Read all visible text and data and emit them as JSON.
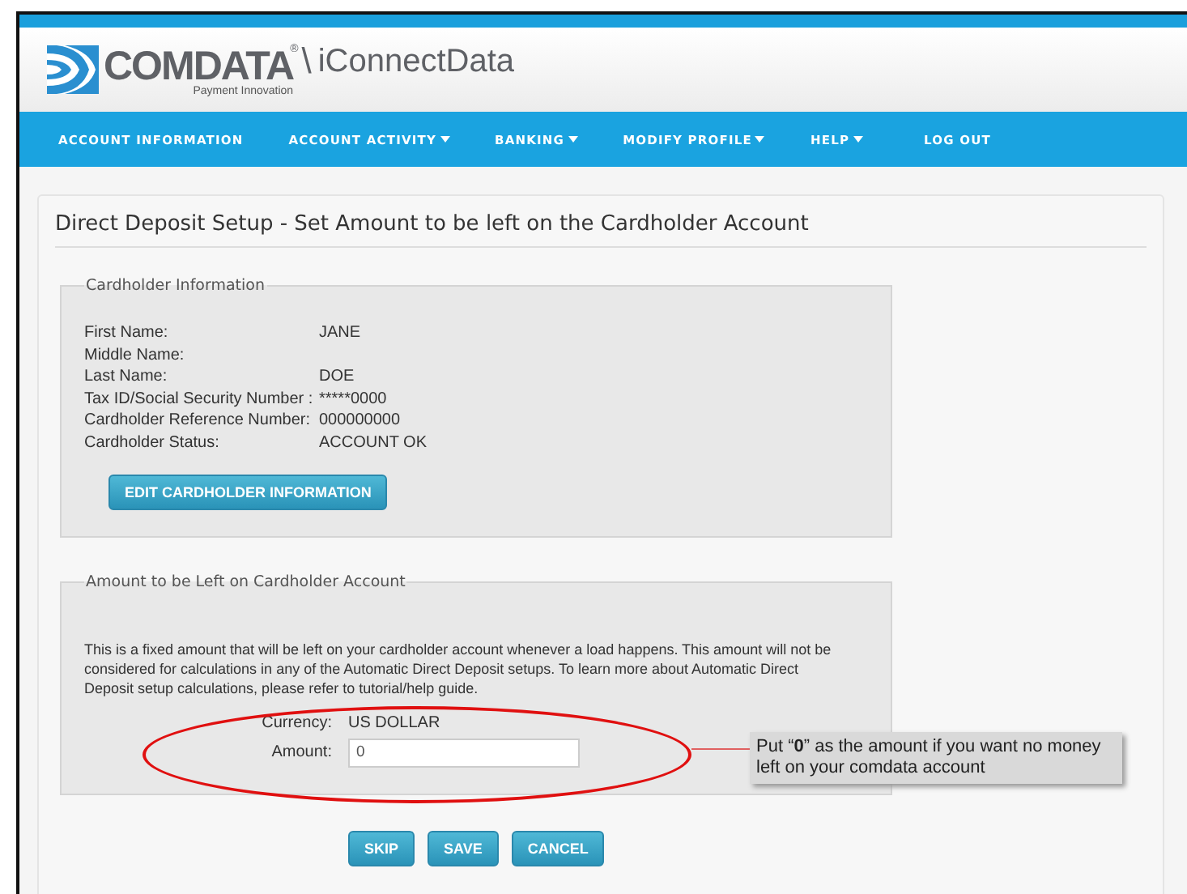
{
  "header": {
    "logo": "COMDATA",
    "logo_mark": "®",
    "tagline": "Payment Innovation",
    "separator": "\\",
    "app_name": "iConnectData"
  },
  "nav": [
    {
      "label": "ACCOUNT INFORMATION",
      "dropdown": false
    },
    {
      "label": "ACCOUNT ACTIVITY",
      "dropdown": true
    },
    {
      "label": "BANKING",
      "dropdown": true
    },
    {
      "label": "MODIFY PROFILE",
      "dropdown": true
    },
    {
      "label": "HELP",
      "dropdown": true
    },
    {
      "label": "LOG OUT",
      "dropdown": false
    }
  ],
  "page_title": "Direct Deposit Setup - Set Amount to be left on the Cardholder Account",
  "cardholder_info": {
    "legend": "Cardholder Information",
    "fields": [
      {
        "label": "First Name:",
        "value": "JANE"
      },
      {
        "label": "Middle Name:"
      },
      {
        "label": "Last Name:",
        "value": "DOE"
      },
      {
        "label": "Tax ID/Social Security Number :",
        "value": "*****0000"
      },
      {
        "label": "Cardholder Reference Number:",
        "value": "000000000"
      },
      {
        "label": "Cardholder Status:",
        "value": "ACCOUNT OK"
      }
    ],
    "button": "EDIT CARDHOLDER INFORMATION"
  },
  "amount_section": {
    "legend": "Amount to be Left on Cardholder Account",
    "description": "This is a fixed amount that will be left on your cardholder account whenever a load happens. This amount will not be considered for calculations in any of the Automatic Direct Deposit setups. To learn more about Automatic Direct Deposit setup calculations, please refer to tutorial/help guide.",
    "currency_label": "Currency:",
    "currency_value": "US DOLLAR",
    "amount_label": "Amount:",
    "amount_value": "0"
  },
  "buttons": [
    "SKIP",
    "SAVE",
    "CANCEL"
  ],
  "annotation": {
    "text": "Put “**0**” as the amount if you want no money left on your comdata account"
  }
}
